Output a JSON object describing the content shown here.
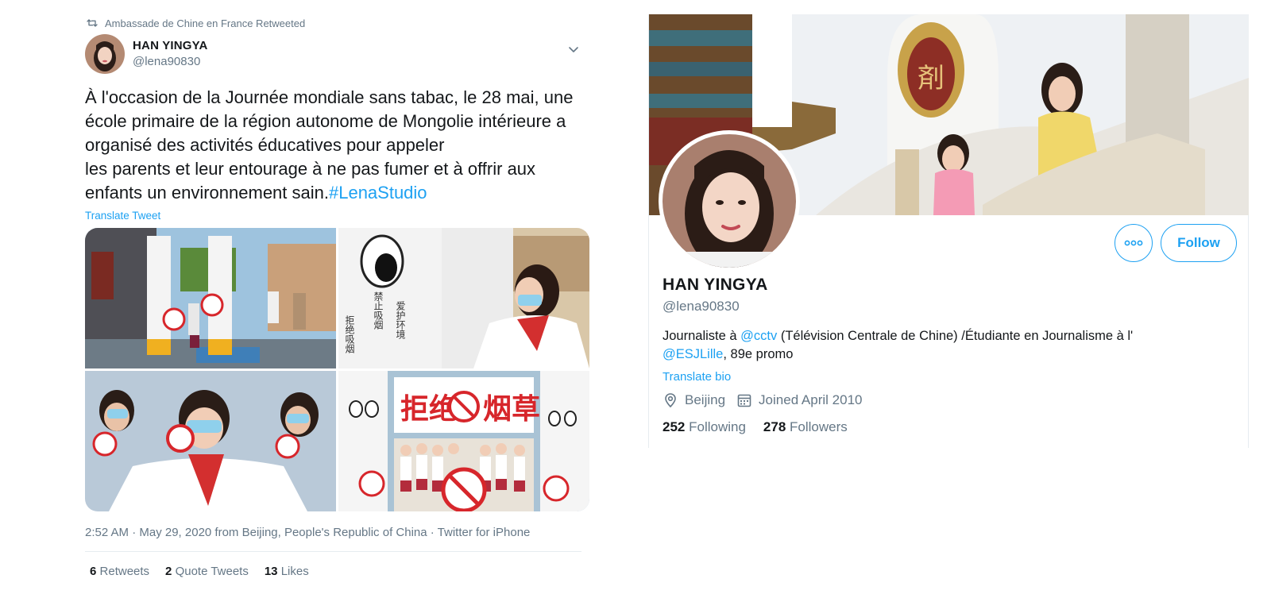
{
  "tweet": {
    "retweet_context": "Ambassade de Chine en France Retweeted",
    "author_name": "HAN YINGYA",
    "author_handle": "@lena90830",
    "text_lines": [
      "À l'occasion de la Journée mondiale sans tabac, le 28 mai, une",
      "école primaire de la région autonome de Mongolie intérieure a",
      "organisé des activités éducatives pour appeler",
      "les parents et leur entourage à ne pas fumer et à offrir aux",
      "enfants un environnement sain."
    ],
    "hashtag": "#LenaStudio",
    "translate_label": "Translate Tweet",
    "meta": "2:52 AM · May 29, 2020 from Beijing, People's Republic of China · Twitter for iPhone",
    "stats": {
      "retweets_count": "6",
      "retweets_label": "Retweets",
      "quotes_count": "2",
      "quotes_label": "Quote Tweets",
      "likes_count": "13",
      "likes_label": "Likes"
    },
    "photo_text": {
      "banner_top": "拒绝",
      "banner_mid": "烟草",
      "side_left": "拒绝吸烟",
      "side_mid": "禁止吸烟",
      "side_right": "爱护环境"
    }
  },
  "profile": {
    "name": "HAN YINGYA",
    "handle": "@lena90830",
    "bio_prefix": "Journaliste à ",
    "bio_mention_1": "@cctv",
    "bio_middle": " (Télévision Centrale de Chine) /Étudiante en Journalisme à l'",
    "bio_mention_2": "@ESJLille",
    "bio_suffix": ", 89e promo",
    "translate_label": "Translate bio",
    "location": "Beijing",
    "joined": "Joined April 2010",
    "following_count": "252",
    "following_label": "Following",
    "followers_count": "278",
    "followers_label": "Followers",
    "follow_button": "Follow",
    "banner_sign": "剤"
  },
  "colors": {
    "accent": "#1da1f2",
    "text": "#14171a",
    "secondary": "#657786",
    "divider": "#e6ecf0"
  },
  "icons": [
    "retweet-icon",
    "chevron-down-icon",
    "more-icon",
    "location-icon",
    "calendar-icon"
  ]
}
